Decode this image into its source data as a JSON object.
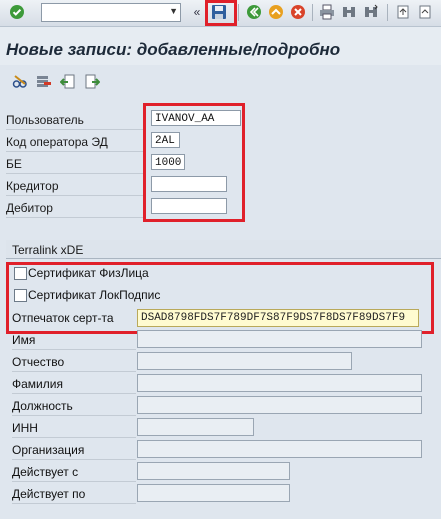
{
  "toolbar": {
    "command_value": "",
    "icons": [
      "enter-icon",
      "dropdown-icon",
      "back-double-icon",
      "save-icon",
      "back-icon",
      "exit-icon",
      "cancel-icon",
      "print-icon",
      "find-icon",
      "find-next-icon",
      "first-page-icon",
      "prev-page-icon"
    ]
  },
  "screen": {
    "title": "Новые записи: добавленные/подробно"
  },
  "app_toolbar": {
    "icons": [
      "edit-glasses-icon",
      "delete-row-icon",
      "prev-entry-icon",
      "next-entry-icon"
    ]
  },
  "header_fields": {
    "user_label": "Пользователь",
    "user_value": "IVANOV_AA",
    "operator_label": "Код оператора ЭД",
    "operator_value": "2AL",
    "be_label": "БЕ",
    "be_value": "1000",
    "creditor_label": "Кредитор",
    "creditor_value": "",
    "debtor_label": "Дебитор",
    "debtor_value": ""
  },
  "terralink": {
    "title": "Terralink xDE",
    "cert_person_label": "Сертификат ФизЛица",
    "cert_person_checked": false,
    "cert_local_label": "Сертификат ЛокПодпис",
    "cert_local_checked": false,
    "thumbprint_label": "Отпечаток серт-та",
    "thumbprint_value": "DSAD8798FDS7F789DF7S87F9DS7F8DS7F89DS7F9",
    "name_label": "Имя",
    "name_value": "",
    "patronymic_label": "Отчество",
    "patronymic_value": "",
    "surname_label": "Фамилия",
    "surname_value": "",
    "position_label": "Должность",
    "position_value": "",
    "inn_label": "ИНН",
    "inn_value": "",
    "org_label": "Организация",
    "org_value": "",
    "valid_from_label": "Действует с",
    "valid_from_value": "",
    "valid_to_label": "Действует по",
    "valid_to_value": ""
  },
  "colors": {
    "highlight_red": "#e0202a",
    "thumbprint_bg": "#fffbd0",
    "background": "#dfe6ee"
  }
}
